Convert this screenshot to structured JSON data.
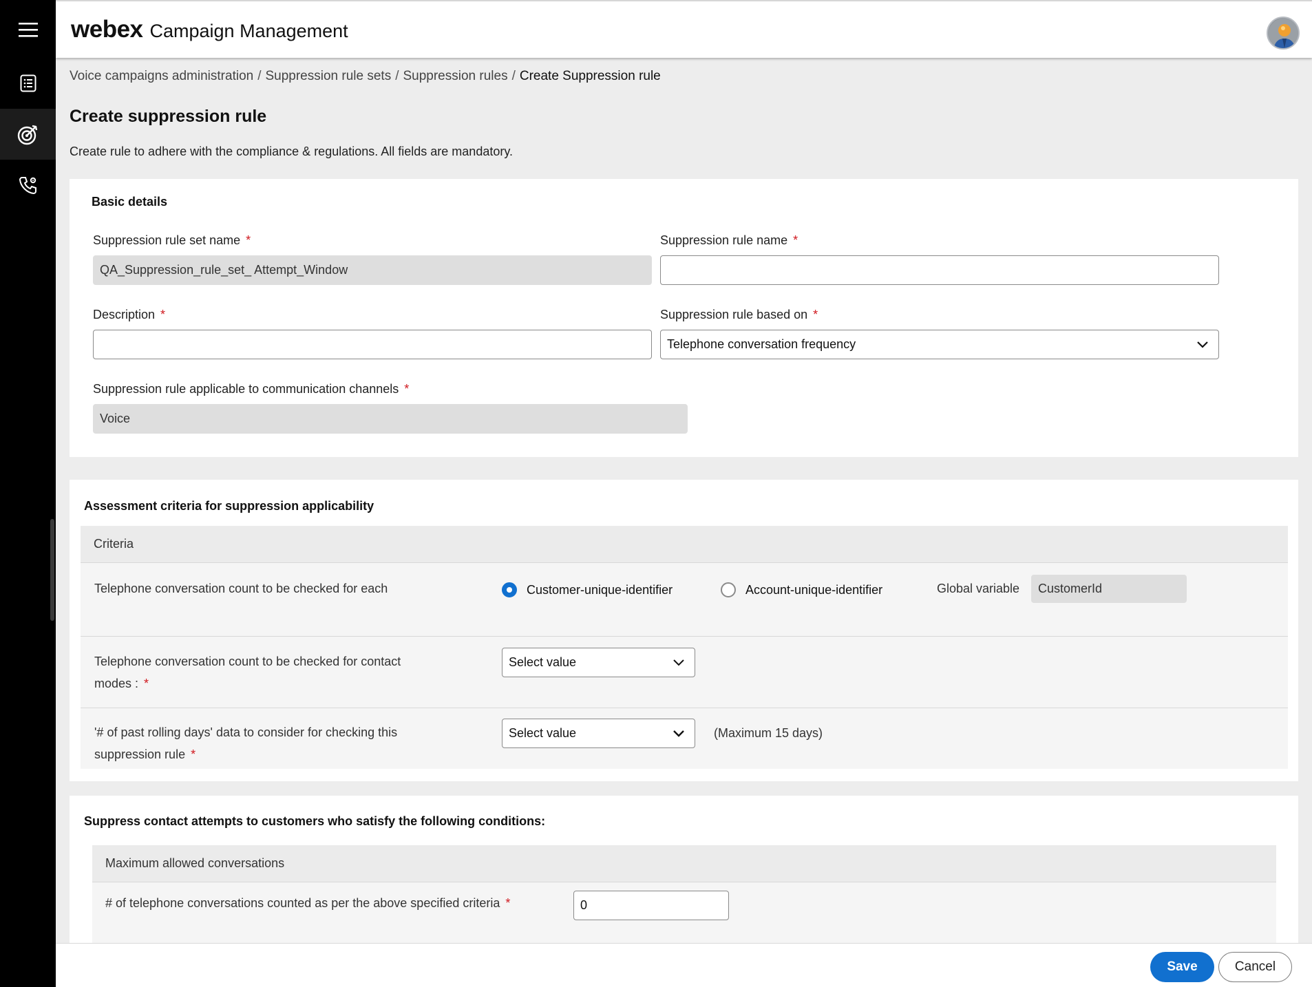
{
  "header": {
    "logo": "webex",
    "product": "Campaign Management"
  },
  "breadcrumb": {
    "items": [
      "Voice campaigns administration",
      "Suppression rule sets",
      "Suppression rules"
    ],
    "separator": "/",
    "current": "Create Suppression rule"
  },
  "page": {
    "title": "Create suppression rule",
    "subtitle": "Create rule to adhere with the compliance & regulations. All fields are mandatory."
  },
  "basic_details": {
    "title": "Basic details",
    "rule_set_name_label": "Suppression rule set name",
    "rule_set_name_value": "QA_Suppression_rule_set_ Attempt_Window",
    "rule_name_label": "Suppression rule name",
    "rule_name_value": "",
    "description_label": "Description",
    "description_value": "",
    "based_on_label": "Suppression rule based on",
    "based_on_value": "Telephone conversation frequency",
    "channels_label": "Suppression rule applicable to communication channels",
    "channels_value": "Voice",
    "required_mark": "*"
  },
  "assessment": {
    "title": "Assessment criteria for suppression applicability",
    "grid_header": "Criteria",
    "row1_label": "Telephone conversation count to be checked for each",
    "radio_customer": "Customer-unique-identifier",
    "radio_account": "Account-unique-identifier",
    "selected_radio": "Customer-unique-identifier",
    "global_variable_label": "Global variable",
    "global_variable_value": "CustomerId",
    "row2_label_line1": "Telephone conversation count to be checked for contact",
    "row2_label_line2": "modes :",
    "row2_select": "Select value",
    "row3_label_line1": "'# of past rolling days' data to consider for checking this",
    "row3_label_line2": "suppression rule",
    "row3_select": "Select value",
    "row3_note": "(Maximum 15 days)"
  },
  "suppress": {
    "title": "Suppress contact attempts to customers who satisfy the following conditions:",
    "grid_header": "Maximum allowed conversations",
    "count_label": "# of telephone conversations counted as per the above specified criteria",
    "count_value": "0"
  },
  "footer": {
    "save_label": "Save",
    "cancel_label": "Cancel"
  },
  "colors": {
    "accent": "#1170cf",
    "required": "#d0191f",
    "rail": "#000000"
  },
  "icons": [
    "menu-icon",
    "list-icon",
    "target-icon",
    "phone-settings-icon",
    "chevron-down-icon"
  ]
}
